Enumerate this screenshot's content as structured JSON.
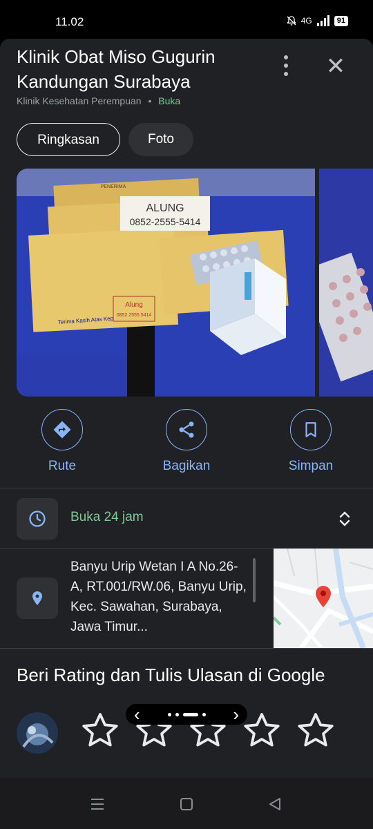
{
  "status_bar": {
    "time": "11.02",
    "network": "4G",
    "battery": "91",
    "icons": [
      "bell-muted-icon",
      "signal-icon",
      "battery-icon"
    ]
  },
  "place": {
    "name": "Klinik Obat Miso Gugurin Kandungan Surabaya",
    "category": "Klinik Kesehatan Perempuan",
    "separator": "•",
    "status": "Buka"
  },
  "header_actions": {
    "more_icon": "more-vert-icon",
    "close_icon": "close-icon",
    "close_glyph": "✕"
  },
  "tabs": [
    {
      "label": "Ringkasan",
      "active": true
    },
    {
      "label": "Foto",
      "active": false
    }
  ],
  "photo_text": {
    "note": "ALUNG",
    "phone": "0852-2555-5414",
    "envelope_top": "PENERIMA",
    "envelope_bottom": "Terima Kasih Atas Kepercayaan Anda",
    "stamp_name": "Alung",
    "stamp_phone": "0852 2555 5414"
  },
  "actions": [
    {
      "label": "Rute",
      "icon": "directions-icon"
    },
    {
      "label": "Bagikan",
      "icon": "share-icon"
    },
    {
      "label": "Simpan",
      "icon": "bookmark-icon"
    }
  ],
  "hours": {
    "text": "Buka 24 jam",
    "icon": "clock-icon",
    "expand_icon": "unfold-icon"
  },
  "address": {
    "text": "Banyu Urip Wetan I A No.26-A, RT.001/RW.06, Banyu Urip, Kec. Sawahan, Surabaya, Jawa Timur...",
    "icon": "location-pin-icon"
  },
  "rating": {
    "title": "Beri Rating dan Tulis Ulasan di Google",
    "star_count": 5
  },
  "pager": {
    "prev": "‹",
    "next": "›"
  },
  "colors": {
    "accent_blue": "#8ab4f8",
    "open_green": "#81c995",
    "background": "#202124",
    "map_pin": "#ea4335"
  }
}
